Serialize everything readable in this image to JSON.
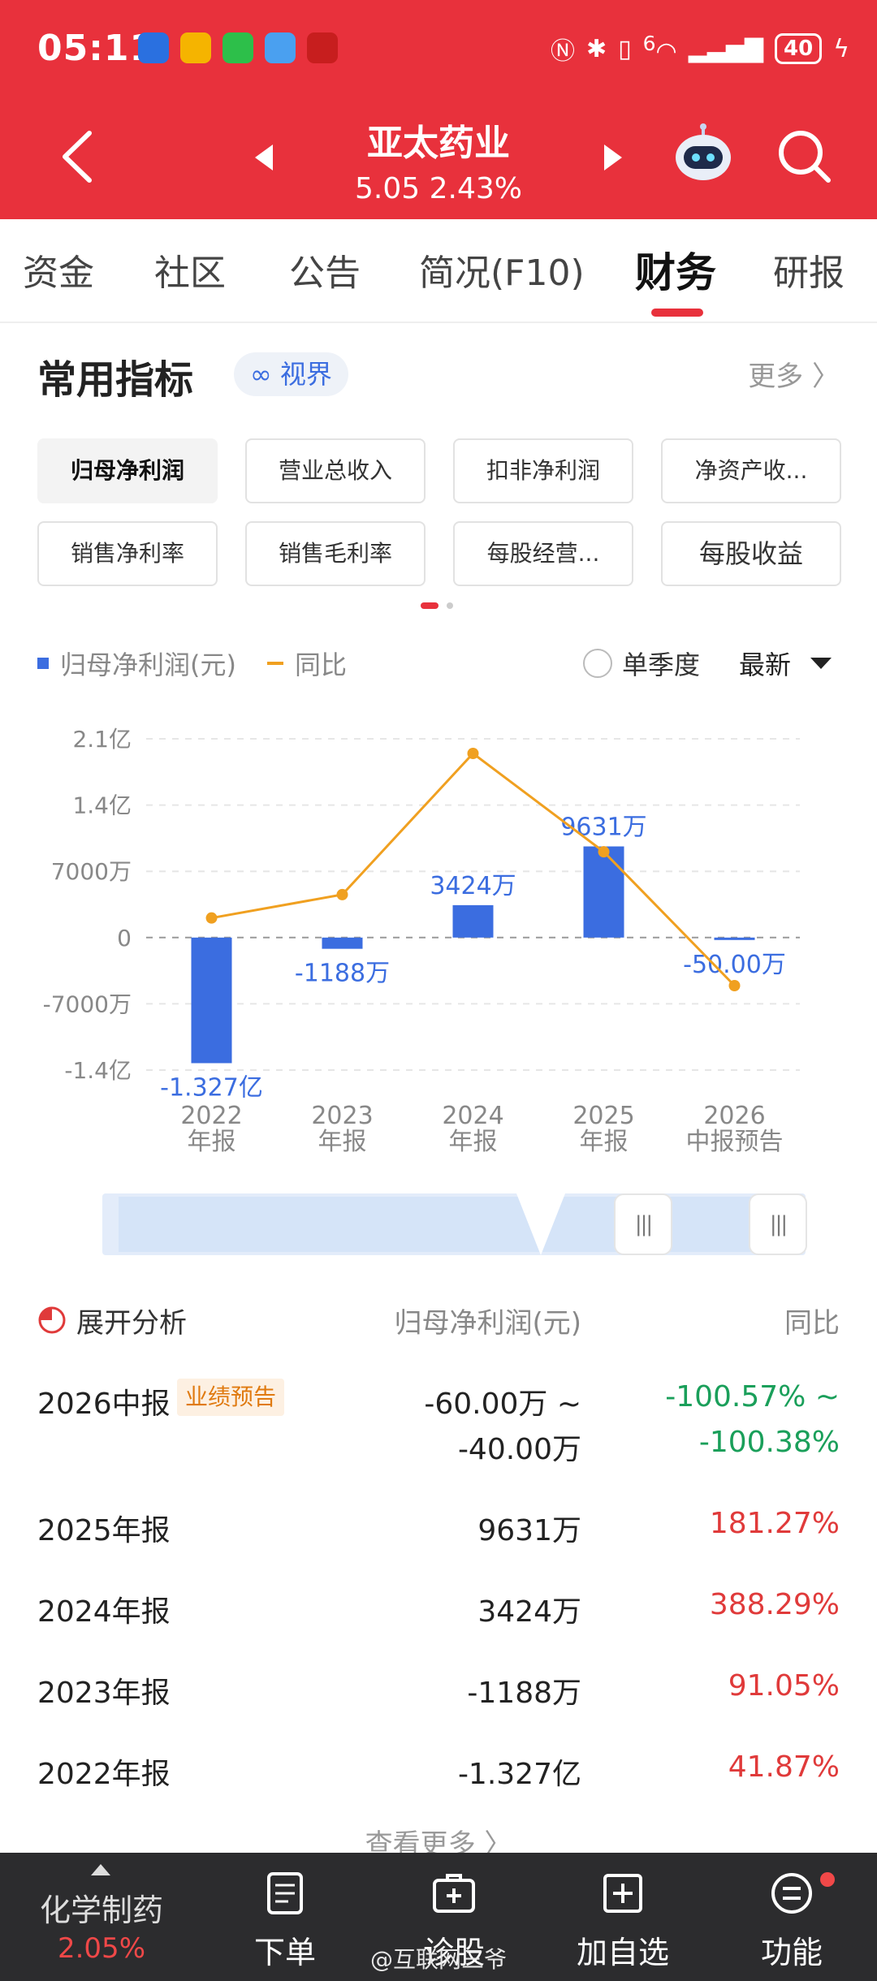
{
  "status_bar": {
    "time": "05:11",
    "network": "6",
    "battery": "40"
  },
  "header": {
    "stock_name": "亚太药业",
    "price_change": "5.05 2.43%"
  },
  "tabs": [
    {
      "label": "资金"
    },
    {
      "label": "社区"
    },
    {
      "label": "公告"
    },
    {
      "label": "简况(F10)"
    },
    {
      "label": "财务",
      "active": true
    },
    {
      "label": "研报"
    }
  ],
  "section": {
    "title": "常用指标",
    "vision_label": "视界",
    "more_label": "更多"
  },
  "chips": [
    {
      "label": "归母净利润",
      "active": true
    },
    {
      "label": "营业总收入"
    },
    {
      "label": "扣非净利润"
    },
    {
      "label": "净资产收..."
    },
    {
      "label": "销售净利率"
    },
    {
      "label": "销售毛利率"
    },
    {
      "label": "每股经营..."
    },
    {
      "label": "每股收益"
    }
  ],
  "legend": {
    "bar_label": "归母净利润(元)",
    "line_label": "同比",
    "quarter_label": "单季度",
    "select_label": "最新"
  },
  "colors": {
    "brand_red": "#e8313c",
    "bar_blue": "#3b6de0",
    "line_orange": "#f0a020",
    "up_red": "#e03a3a",
    "down_green": "#1a9f5a"
  },
  "chart_data": {
    "type": "bar",
    "categories": [
      "2022\n年报",
      "2023\n年报",
      "2024\n年报",
      "2025\n年报",
      "2026\n中报预告"
    ],
    "category_lines": [
      [
        "2022",
        "年报"
      ],
      [
        "2023",
        "年报"
      ],
      [
        "2024",
        "年报"
      ],
      [
        "2025",
        "年报"
      ],
      [
        "2026",
        "中报预告"
      ]
    ],
    "series": [
      {
        "name": "归母净利润(元)",
        "type": "bar",
        "values": [
          -132700000,
          -11880000,
          34240000,
          96310000,
          -500000
        ],
        "data_labels": [
          "-1.327亿",
          "-1188万",
          "3424万",
          "9631万",
          "-50.00万"
        ]
      },
      {
        "name": "同比",
        "type": "line",
        "values": [
          41.87,
          91.05,
          388.29,
          181.27,
          -100.57
        ]
      }
    ],
    "yticks": [
      210000000,
      140000000,
      70000000,
      0,
      -70000000,
      -140000000
    ],
    "ytick_labels": [
      "2.1亿",
      "1.4亿",
      "7000万",
      "0",
      "-7000万",
      "-1.4亿"
    ],
    "ylim": [
      -140000000,
      210000000
    ],
    "y2lim": [
      -100.57,
      388.29
    ],
    "grid": true
  },
  "analysis": {
    "title": "展开分析",
    "col_value": "归母净利润(元)",
    "col_yoy": "同比",
    "badge": "业绩预告",
    "rows": [
      {
        "period": "2026中报",
        "value_line1": "-60.00万 ~",
        "value_line2": "-40.00万",
        "yoy_line1": "-100.57% ~",
        "yoy_line2": "-100.38%"
      },
      {
        "period": "2025年报",
        "value": "9631万",
        "yoy": "181.27%"
      },
      {
        "period": "2024年报",
        "value": "3424万",
        "yoy": "388.29%"
      },
      {
        "period": "2023年报",
        "value": "-1188万",
        "yoy": "91.05%"
      },
      {
        "period": "2022年报",
        "value": "-1.327亿",
        "yoy": "41.87%"
      }
    ],
    "see_more": "查看更多 〉"
  },
  "bottom_bar": {
    "sector_name": "化学制药",
    "sector_change": "2.05%",
    "items": [
      {
        "label": "下单",
        "icon": "order-doc-icon"
      },
      {
        "label": "诊股",
        "icon": "diagnose-icon"
      },
      {
        "label": "加自选",
        "icon": "add-watchlist-icon"
      },
      {
        "label": "功能",
        "icon": "menu-icon"
      }
    ],
    "watermark": "@互联网三爷"
  }
}
